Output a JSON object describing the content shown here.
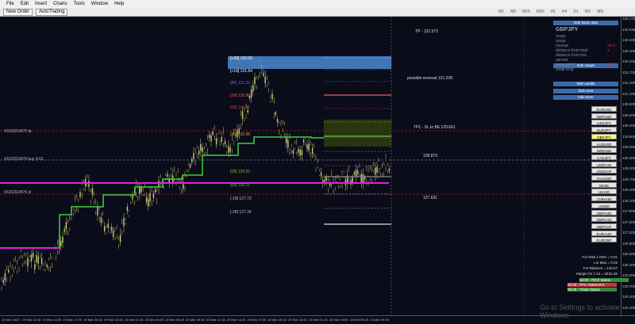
{
  "menu": [
    "File",
    "Edit",
    "Insert",
    "Charts",
    "Tools",
    "Window",
    "Help"
  ],
  "toolbar": {
    "new_order": "New Order",
    "autotrading": "AutoTrading",
    "timeframes": [
      "M1",
      "M5",
      "M15",
      "M30",
      "H1",
      "H4",
      "D1",
      "W1",
      "MN"
    ]
  },
  "panel": {
    "symbol": "GBPJPY",
    "hide_basic": "hide basic data",
    "hide_swaps": "hide swaps",
    "hide_candle": "hide candle",
    "hide_area": "hide area",
    "hide_timer": "hide timer",
    "rows": [
      "range",
      "range",
      "change",
      "distance from high",
      "distance from low",
      "spread",
      "swap short",
      "swap long"
    ],
    "values": [
      "-",
      "-",
      "+0.2",
      "+",
      "-",
      "-",
      "+0.2",
      "-"
    ]
  },
  "symbols": [
    "EURUSD",
    "GBPUSD",
    "USDJPY",
    "EURJPY",
    "GBPJPY",
    "AUDUSD",
    "NZDUSD",
    "CADJPY",
    "USDCAD",
    "USDCHF",
    "XAUUSD",
    "NKSE",
    "UK100",
    "CHINA50",
    "US500",
    "GBPAUD",
    "GBPCAD",
    "GBPCHF",
    "EURAUD",
    "EURGBP"
  ],
  "active_symbol": "GBPJPY",
  "chart_labels": {
    "tp": "TP - 132.573",
    "reversal": "possible reversal 131.238",
    "tp1": "TP1 - SL to BE 129.661",
    "current": "128.873",
    "sl": "127.631",
    "fibs": [
      "[+28]  132.03",
      "[+18]  131.64",
      "[88]  131.25",
      "[78]  130.86",
      "[68]  130.47",
      "[38]  130.08",
      "[18]  129.52",
      "[08]  128.11",
      "[-18]  127.73",
      "[-28]  127.34"
    ],
    "left1": "#3162|10476 tp",
    "left2": "#3162|10476 buy 0.01",
    "left3": "#3162|10476 sl"
  },
  "account": [
    "For Risk 1.00% = 0.01",
    "Lot Max = 0.03",
    "For Balance = 140.57",
    "Margin for 1 lot = 3E31.66"
  ],
  "status_bars": [
    "00:00 - Pitch Status",
    "05:30 - PFC Statement",
    "06:00 - Trade Status"
  ],
  "watermark": "Go to Settings to activate Windows",
  "xaxis": [
    "19 Mar 2020",
    "19 Mar 12:15",
    "19 Mar 14:00",
    "19 Mar 17:45",
    "19 Mar 20:15",
    "19 Mar 22:00",
    "20 Mar 01:15",
    "20 Mar 04:00",
    "20 Mar 06:45",
    "20 Mar 09:30",
    "20 Mar 12:15",
    "20 Mar 14:15",
    "20 Mar 17:00",
    "20 Mar 20:15",
    "20 Mar 22:00",
    "23 Mar 01:15",
    "23 Mar 04:00",
    "23 Mar 06:45",
    "23 Mar 09:30"
  ],
  "yaxis": [
    "133.170",
    "132.930",
    "132.600",
    "132.300",
    "132.000",
    "131.700",
    "131.400",
    "131.100",
    "130.800",
    "130.500",
    "130.200",
    "129.900",
    "129.600",
    "129.300",
    "129.000",
    "128.700",
    "128.400",
    "128.100",
    "127.800",
    "127.500",
    "127.200",
    "126.900",
    "126.600",
    "126.300",
    "126.000",
    "125.700",
    "125.400",
    "125.100"
  ]
}
